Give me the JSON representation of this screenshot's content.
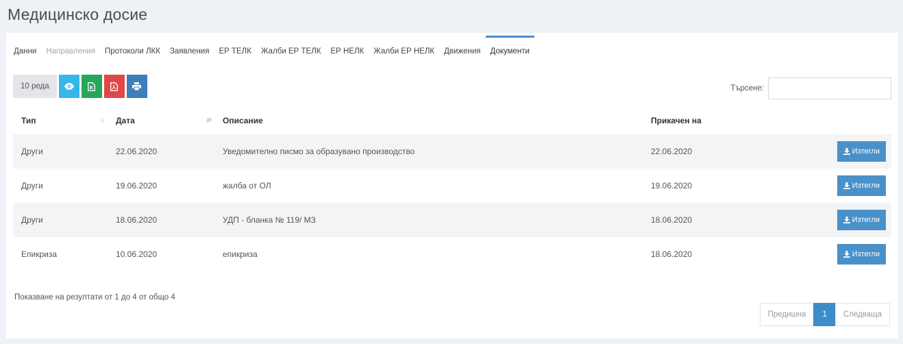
{
  "page": {
    "title": "Медицинско досие"
  },
  "tabs": [
    {
      "label": "Данни"
    },
    {
      "label": "Направления"
    },
    {
      "label": "Протоколи ЛКК"
    },
    {
      "label": "Заявления"
    },
    {
      "label": "ЕР ТЕЛК"
    },
    {
      "label": "Жалби ЕР ТЕЛК"
    },
    {
      "label": "ЕР НЕЛК"
    },
    {
      "label": "Жалби ЕР НЕЛК"
    },
    {
      "label": "Движения"
    },
    {
      "label": "Документи"
    }
  ],
  "toolbar": {
    "page_length_label": "10 реда",
    "buttons": [
      "eye-icon",
      "excel-icon",
      "pdf-icon",
      "print-icon"
    ],
    "colors": {
      "eye": "#35b7e8",
      "excel": "#26a65b",
      "pdf": "#e04848",
      "print": "#3d7fb8"
    }
  },
  "search": {
    "label": "Търсене:",
    "value": ""
  },
  "table": {
    "headers": {
      "type": "Тип",
      "date": "Дата",
      "description": "Описание",
      "attached": "Прикачен на"
    },
    "rows": [
      {
        "type": "Други",
        "date": "22.06.2020",
        "description": "Уведомително писмо за образувано производство",
        "attached": "22.06.2020",
        "action": "Изтегли"
      },
      {
        "type": "Други",
        "date": "19.06.2020",
        "description": "жалба от ОЛ",
        "attached": "19.06.2020",
        "action": "Изтегли"
      },
      {
        "type": "Други",
        "date": "18.06.2020",
        "description": "УДП - бланка № 119/ МЗ",
        "attached": "18.06.2020",
        "action": "Изтегли"
      },
      {
        "type": "Епикриза",
        "date": "10.06.2020",
        "description": "епикриза",
        "attached": "18.06.2020",
        "action": "Изтегли"
      }
    ]
  },
  "info": "Показване на резултати от 1 до 4 от общо 4",
  "pagination": {
    "previous": "Предишна",
    "current": "1",
    "next": "Следваща"
  }
}
